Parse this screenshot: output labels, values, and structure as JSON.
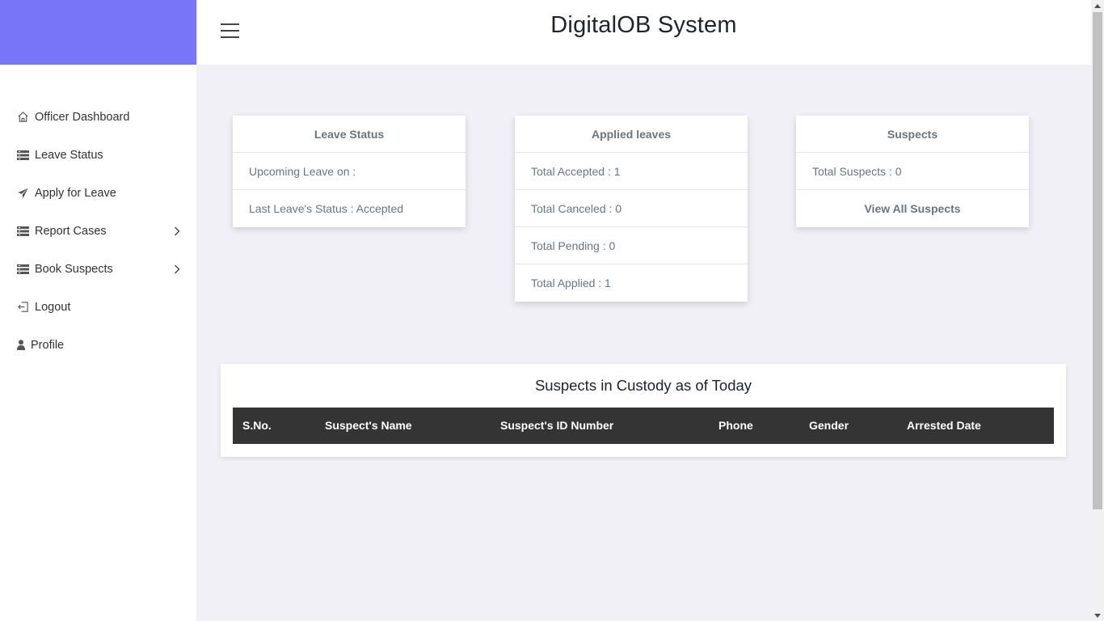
{
  "header": {
    "title": "DigitalOB System"
  },
  "sidebar": {
    "brand_color": "#7875f8",
    "items": [
      {
        "label": "Officer Dashboard",
        "icon": "home-icon"
      },
      {
        "label": "Leave Status",
        "icon": "list-icon"
      },
      {
        "label": "Apply for Leave",
        "icon": "paper-plane-icon"
      },
      {
        "label": "Report Cases",
        "icon": "list-icon",
        "has_submenu": true
      },
      {
        "label": "Book Suspects",
        "icon": "list-icon",
        "has_submenu": true
      },
      {
        "label": "Logout",
        "icon": "logout-icon"
      },
      {
        "label": "Profile",
        "icon": "user-icon"
      }
    ]
  },
  "cards": {
    "leave_status": {
      "title": "Leave Status",
      "rows": [
        "Upcoming Leave on :",
        "Last Leave's Status : Accepted"
      ]
    },
    "applied_leaves": {
      "title": "Applied leaves",
      "rows": [
        "Total Accepted : 1",
        "Total Canceled : 0",
        "Total Pending : 0",
        "Total Applied : 1"
      ]
    },
    "suspects": {
      "title": "Suspects",
      "rows": [
        "Total Suspects : 0"
      ],
      "link": "View All Suspects"
    }
  },
  "custody": {
    "title": "Suspects in Custody as of Today",
    "columns": [
      "S.No.",
      "Suspect's Name",
      "Suspect's ID Number",
      "Phone",
      "Gender",
      "Arrested Date"
    ]
  }
}
